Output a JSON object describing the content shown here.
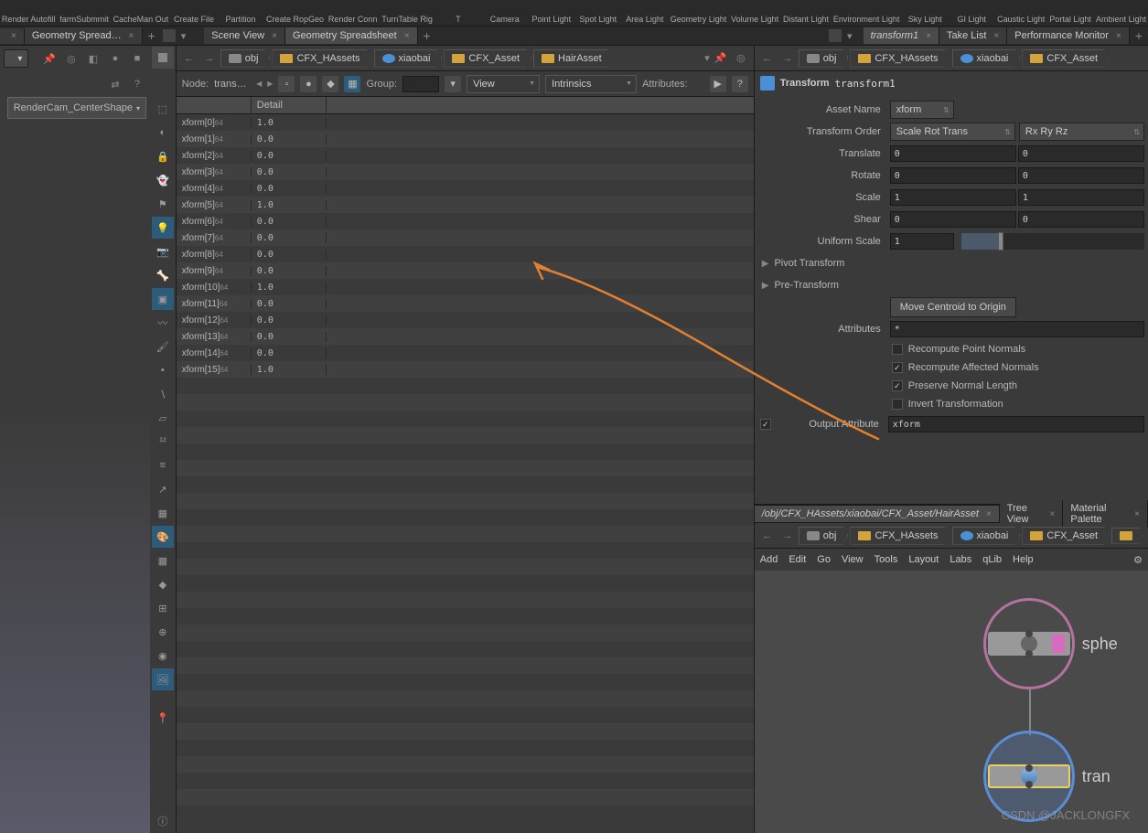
{
  "shelf": [
    {
      "label": "Render Autofill"
    },
    {
      "label": "farmSubmmit"
    },
    {
      "label": "CacheMan Out"
    },
    {
      "label": "Create File"
    },
    {
      "label": "Partition"
    },
    {
      "label": "Create RopGeo"
    },
    {
      "label": "Render Conn"
    },
    {
      "label": "TurnTable Rig"
    },
    {
      "label": "T"
    },
    {
      "label": "Camera"
    },
    {
      "label": "Point Light"
    },
    {
      "label": "Spot Light"
    },
    {
      "label": "Area Light"
    },
    {
      "label": "Geometry Light"
    },
    {
      "label": "Volume Light"
    },
    {
      "label": "Distant Light"
    },
    {
      "label": "Environment Light"
    },
    {
      "label": "Sky Light"
    },
    {
      "label": "GI Light"
    },
    {
      "label": "Caustic Light"
    },
    {
      "label": "Portal Light"
    },
    {
      "label": "Ambient Light"
    }
  ],
  "tabsLeft": [
    {
      "label": "",
      "close": true
    },
    {
      "label": "Geometry Spread…",
      "close": true
    }
  ],
  "tabsMid": [
    {
      "label": "Scene View",
      "close": true
    },
    {
      "label": "Geometry Spreadsheet",
      "close": true
    }
  ],
  "tabsRight": [
    {
      "label": "transform1",
      "close": true,
      "italic": true
    },
    {
      "label": "Take List",
      "close": true
    },
    {
      "label": "Performance Monitor",
      "close": true
    }
  ],
  "viewport": {
    "camera": "RenderCam_CenterShape"
  },
  "breadcrumbs": [
    "obj",
    "CFX_HAssets",
    "xiaobai",
    "CFX_Asset",
    "HairAsset"
  ],
  "spreadsheet": {
    "nodeLabel": "Node:",
    "nodeValue": "trans…",
    "groupLabel": "Group:",
    "viewLabel": "View",
    "intrinsicsLabel": "Intrinsics",
    "attributesLabel": "Attributes:",
    "headerCol": "Detail",
    "rows": [
      {
        "name": "xform[0]",
        "sub": "64",
        "val": "1.0"
      },
      {
        "name": "xform[1]",
        "sub": "64",
        "val": "0.0"
      },
      {
        "name": "xform[2]",
        "sub": "64",
        "val": "0.0"
      },
      {
        "name": "xform[3]",
        "sub": "64",
        "val": "0.0"
      },
      {
        "name": "xform[4]",
        "sub": "64",
        "val": "0.0"
      },
      {
        "name": "xform[5]",
        "sub": "64",
        "val": "1.0"
      },
      {
        "name": "xform[6]",
        "sub": "64",
        "val": "0.0"
      },
      {
        "name": "xform[7]",
        "sub": "64",
        "val": "0.0"
      },
      {
        "name": "xform[8]",
        "sub": "64",
        "val": "0.0"
      },
      {
        "name": "xform[9]",
        "sub": "64",
        "val": "0.0"
      },
      {
        "name": "xform[10]",
        "sub": "64",
        "val": "1.0"
      },
      {
        "name": "xform[11]",
        "sub": "64",
        "val": "0.0"
      },
      {
        "name": "xform[12]",
        "sub": "64",
        "val": "0.0"
      },
      {
        "name": "xform[13]",
        "sub": "64",
        "val": "0.0"
      },
      {
        "name": "xform[14]",
        "sub": "64",
        "val": "0.0"
      },
      {
        "name": "xform[15]",
        "sub": "64",
        "val": "1.0"
      }
    ]
  },
  "params": {
    "title": "Transform",
    "nodeName": "transform1",
    "assetNameLabel": "Asset Name",
    "assetName": "xform",
    "transformOrderLabel": "Transform Order",
    "transformOrder": "Scale Rot Trans",
    "rotOrder": "Rx Ry Rz",
    "translateLabel": "Translate",
    "translate": [
      "0",
      "0"
    ],
    "rotateLabel": "Rotate",
    "rotate": [
      "0",
      "0"
    ],
    "scaleLabel": "Scale",
    "scale": [
      "1",
      "1"
    ],
    "shearLabel": "Shear",
    "shear": [
      "0",
      "0"
    ],
    "uniformScaleLabel": "Uniform Scale",
    "uniformScale": "1",
    "pivotLabel": "Pivot Transform",
    "preTransLabel": "Pre-Transform",
    "moveCentroidBtn": "Move Centroid to Origin",
    "attributesLabel": "Attributes",
    "attributesVal": "*",
    "checks": [
      {
        "label": "Recompute Point Normals",
        "checked": false
      },
      {
        "label": "Recompute Affected Normals",
        "checked": true
      },
      {
        "label": "Preserve Normal Length",
        "checked": true
      },
      {
        "label": "Invert Transformation",
        "checked": false
      }
    ],
    "outputAttrLabel": "Output Attribute",
    "outputAttr": "xform"
  },
  "netTabs": [
    {
      "label": "/obj/CFX_HAssets/xiaobai/CFX_Asset/HairAsset",
      "close": true,
      "italic": true
    },
    {
      "label": "Tree View",
      "close": true
    },
    {
      "label": "Material Palette",
      "close": true
    }
  ],
  "netCrumbs": [
    "obj",
    "CFX_HAssets",
    "xiaobai",
    "CFX_Asset"
  ],
  "netMenu": [
    "Add",
    "Edit",
    "Go",
    "View",
    "Tools",
    "Layout",
    "Labs",
    "qLib",
    "Help"
  ],
  "nodes": {
    "sphere": "sphe",
    "transform": "tran"
  },
  "watermark": "CSDN @JACKLONGFX"
}
